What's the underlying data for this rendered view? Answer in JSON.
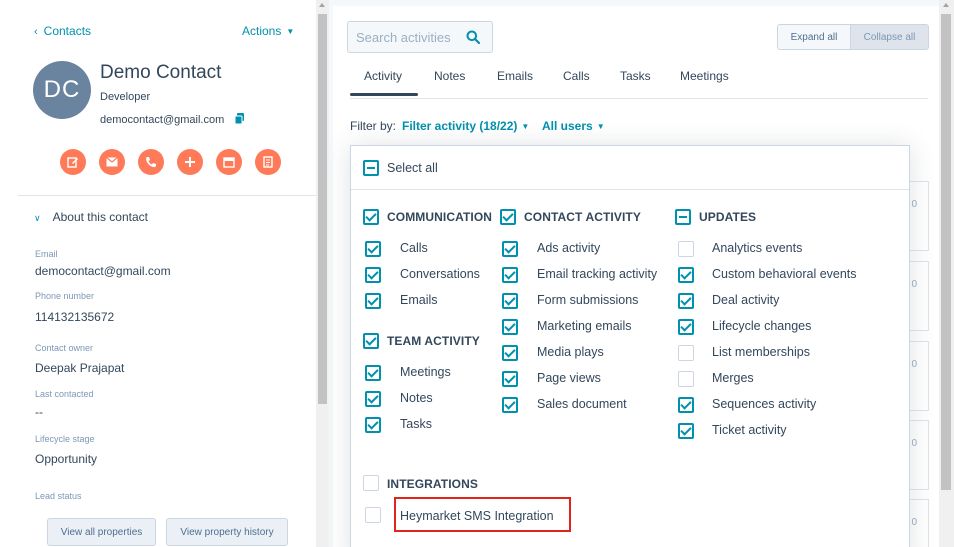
{
  "left": {
    "back_label": "Contacts",
    "actions_label": "Actions",
    "avatar_initials": "DC",
    "name": "Demo Contact",
    "job_title": "Developer",
    "email": "democontact@gmail.com",
    "action_icons": [
      "note-icon",
      "email-icon",
      "call-icon",
      "add-icon",
      "meeting-icon",
      "task-icon"
    ],
    "about_label": "About this contact",
    "properties": [
      {
        "label": "Email",
        "value": "democontact@gmail.com"
      },
      {
        "label": "Phone number",
        "value": "114132135672"
      },
      {
        "label": "Contact owner",
        "value": "Deepak Prajapat"
      },
      {
        "label": "Last contacted",
        "value": "--"
      },
      {
        "label": "Lifecycle stage",
        "value": "Opportunity"
      },
      {
        "label": "Lead status",
        "value": ""
      }
    ],
    "view_all_label": "View all properties",
    "view_history_label": "View property history"
  },
  "right": {
    "search_placeholder": "Search activities",
    "expand_label": "Expand all",
    "collapse_label": "Collapse all",
    "tabs": [
      "Activity",
      "Notes",
      "Emails",
      "Calls",
      "Tasks",
      "Meetings"
    ],
    "active_tab": "Activity",
    "filter_by_label": "Filter by:",
    "filter_activity_label": "Filter activity (18/22)",
    "all_users_label": "All users",
    "card_values": [
      "0",
      "0",
      "0",
      "0",
      "0"
    ]
  },
  "filter_menu": {
    "select_all_label": "Select all",
    "groups": {
      "communication": {
        "label": "COMMUNICATION",
        "items": [
          "Calls",
          "Conversations",
          "Emails"
        ]
      },
      "team_activity": {
        "label": "TEAM ACTIVITY",
        "items": [
          "Meetings",
          "Notes",
          "Tasks"
        ]
      },
      "contact_activity": {
        "label": "CONTACT ACTIVITY",
        "items": [
          "Ads activity",
          "Email tracking activity",
          "Form submissions",
          "Marketing emails",
          "Media plays",
          "Page views",
          "Sales document"
        ]
      },
      "updates": {
        "label": "UPDATES",
        "items": [
          "Analytics events",
          "Custom behavioral events",
          "Deal activity",
          "Lifecycle changes",
          "List memberships",
          "Merges",
          "Sequences activity",
          "Ticket activity"
        ]
      },
      "integrations": {
        "label": "INTEGRATIONS",
        "items": [
          "Heymarket SMS Integration"
        ]
      }
    }
  },
  "colors": {
    "accent": "#0091ae",
    "action_orange": "#ff7a59",
    "highlight_red": "#e0241b",
    "text": "#33475b"
  }
}
